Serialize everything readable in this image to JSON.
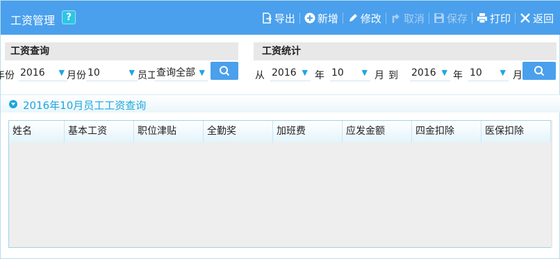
{
  "window": {
    "title": "工资管理",
    "help_label": "?"
  },
  "toolbar": {
    "export": "导出",
    "add": "新增",
    "edit": "修改",
    "cancel": "取消",
    "save": "保存",
    "print": "打印",
    "back": "返回"
  },
  "query_panel": {
    "title": "工资查询",
    "year_label": "年份",
    "year_value": "2016",
    "month_label": "月份",
    "month_value": "10",
    "employee_label": "员工",
    "employee_value": "查询全部"
  },
  "stats_panel": {
    "title": "工资统计",
    "from_label": "从",
    "from_year": "2016",
    "year_label": "年",
    "from_month": "10",
    "month_label": "月",
    "to_label": "到",
    "to_year": "2016",
    "to_year_label": "年",
    "to_month": "10",
    "to_month_label": "月"
  },
  "section": {
    "title": "2016年10月员工工资查询"
  },
  "table": {
    "columns": [
      "姓名",
      "基本工资",
      "职位津贴",
      "全勤奖",
      "加班费",
      "应发金额",
      "四金扣除",
      "医保扣除"
    ],
    "rows": []
  },
  "colors": {
    "accent": "#4aa0ec",
    "section_text": "#1ea7dd"
  }
}
